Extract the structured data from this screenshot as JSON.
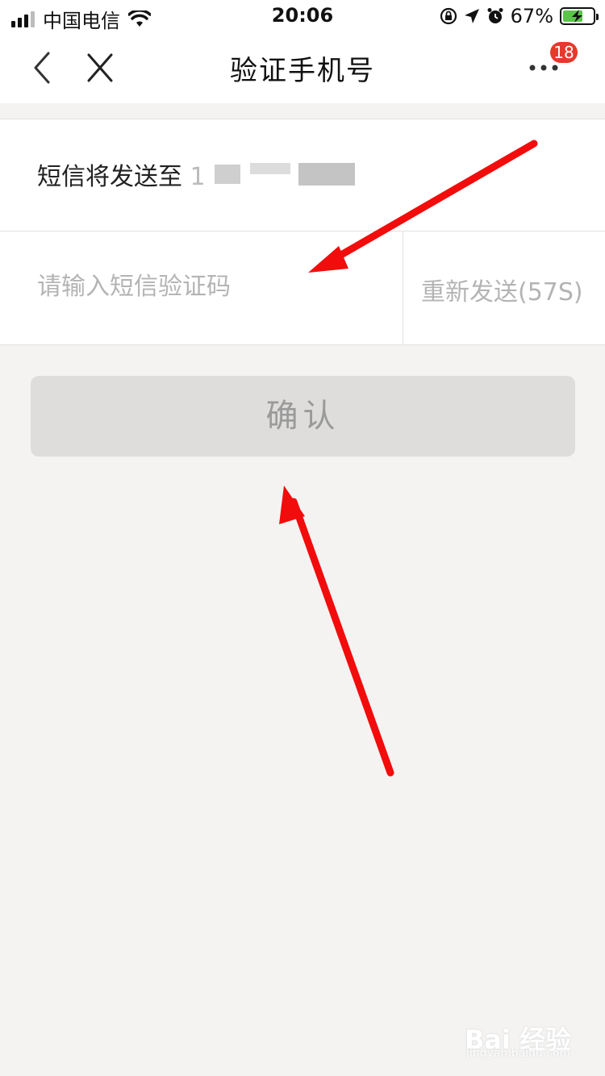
{
  "status_bar": {
    "carrier": "中国电信",
    "time": "20:06",
    "battery_text": "67%",
    "battery_level": 0.67
  },
  "nav": {
    "title": "验证手机号",
    "badge_count": "18",
    "back_icon": "chevron-left-icon",
    "close_icon": "close-icon",
    "more_icon": "more-dots-icon"
  },
  "info": {
    "prefix": "短信将发送至",
    "phone_visible_digit": "1"
  },
  "input": {
    "placeholder": "请输入短信验证码",
    "value": ""
  },
  "resend": {
    "label": "重新发送(57S)"
  },
  "confirm": {
    "label": "确认"
  },
  "watermark": {
    "main": "Bai 经验",
    "sub": "jingyan.baidu.com"
  },
  "colors": {
    "annotation_arrow": "#f20c0c",
    "badge": "#e8372c",
    "page_bg": "#f4f3f2",
    "disabled_button_bg": "#dedddb"
  }
}
